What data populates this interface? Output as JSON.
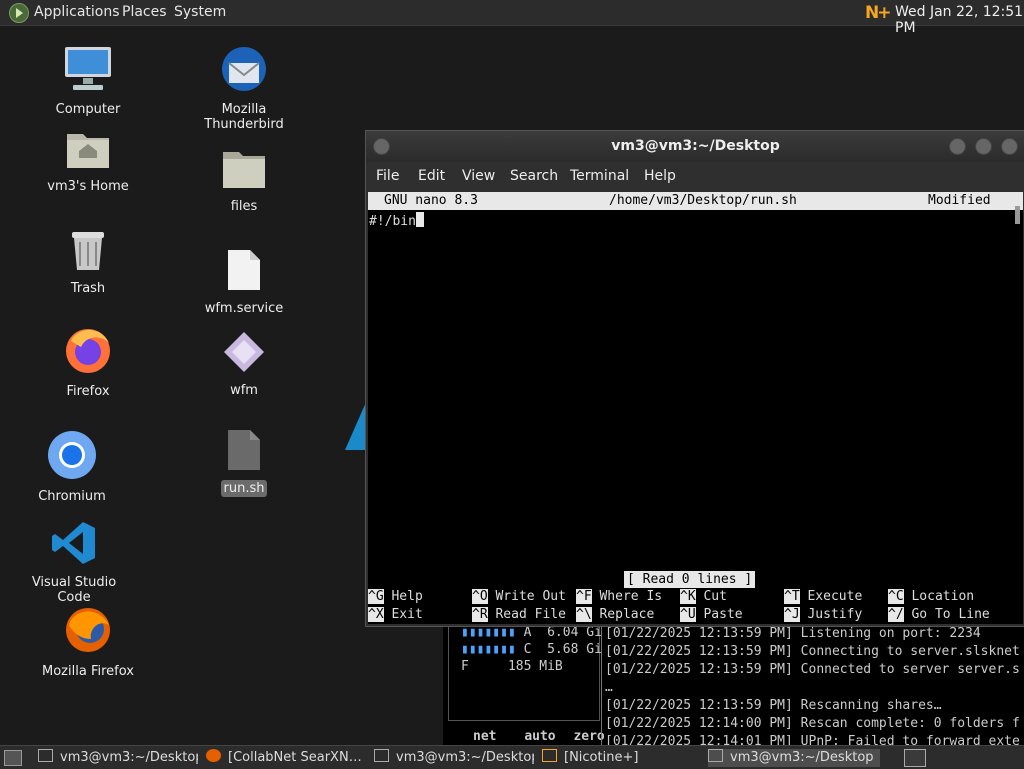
{
  "topbar": {
    "menus": [
      "Applications",
      "Places",
      "System"
    ],
    "tray_icon": "nicotine-plus-icon",
    "clock": "Wed Jan 22, 12:51 PM"
  },
  "desktop_icons": [
    {
      "label": "Computer",
      "icon": "computer-icon"
    },
    {
      "label": "vm3's Home",
      "icon": "home-folder-icon"
    },
    {
      "label": "Trash",
      "icon": "trash-icon"
    },
    {
      "label": "Firefox",
      "icon": "firefox-icon"
    },
    {
      "label": "Chromium",
      "icon": "chromium-icon"
    },
    {
      "label": "Visual Studio Code",
      "icon": "vscode-icon"
    },
    {
      "label": "Mozilla Firefox",
      "icon": "firefox-icon"
    },
    {
      "label": "Mozilla Thunderbird",
      "icon": "thunderbird-icon"
    },
    {
      "label": "files",
      "icon": "folder-icon"
    },
    {
      "label": "wfm.service",
      "icon": "file-icon"
    },
    {
      "label": "wfm",
      "icon": "wfm-icon"
    },
    {
      "label": "run.sh",
      "icon": "script-file-icon"
    }
  ],
  "window": {
    "title": "vm3@vm3:~/Desktop",
    "menu": [
      "File",
      "Edit",
      "View",
      "Search",
      "Terminal",
      "Help"
    ]
  },
  "nano": {
    "version": "GNU nano 8.3",
    "path": "/home/vm3/Desktop/run.sh",
    "state": "Modified",
    "content": "#!/bin",
    "status": "[ Read 0 lines ]",
    "shortcuts": [
      {
        "key": "^G",
        "label": "Help"
      },
      {
        "key": "^O",
        "label": "Write Out"
      },
      {
        "key": "^F",
        "label": "Where Is"
      },
      {
        "key": "^K",
        "label": "Cut"
      },
      {
        "key": "^T",
        "label": "Execute"
      },
      {
        "key": "^C",
        "label": "Location"
      },
      {
        "key": "^X",
        "label": "Exit"
      },
      {
        "key": "^R",
        "label": "Read File"
      },
      {
        "key": "^\\",
        "label": "Replace"
      },
      {
        "key": "^U",
        "label": "Paste"
      },
      {
        "key": "^J",
        "label": "Justify"
      },
      {
        "key": "^/",
        "label": "Go To Line"
      }
    ]
  },
  "background_terminal": {
    "stats": [
      "A  6.04 Gi",
      "C  5.68 Gi",
      "F     185 MiB"
    ],
    "footer": [
      "net",
      "auto",
      "zero"
    ],
    "log": [
      "[01/22/2025 12:13:59 PM] Listening on port: 2234",
      "[01/22/2025 12:13:59 PM] Connecting to server.slsknet",
      "[01/22/2025 12:13:59 PM] Connected to server server.s",
      "…",
      "[01/22/2025 12:13:59 PM] Rescanning shares…",
      "[01/22/2025 12:14:00 PM] Rescan complete: 0 folders f",
      "[01/22/2025 12:14:01 PM] UPnP: Failed to forward exte"
    ]
  },
  "taskbar": {
    "tasks": [
      {
        "label": "vm3@vm3:~/Desktop",
        "active": false
      },
      {
        "label": "[CollabNet SearXN…",
        "active": false
      },
      {
        "label": "vm3@vm3:~/Desktop",
        "active": false
      },
      {
        "label": "[Nicotine+]",
        "active": false
      },
      {
        "label": "vm3@vm3:~/Desktop",
        "active": true
      }
    ]
  }
}
